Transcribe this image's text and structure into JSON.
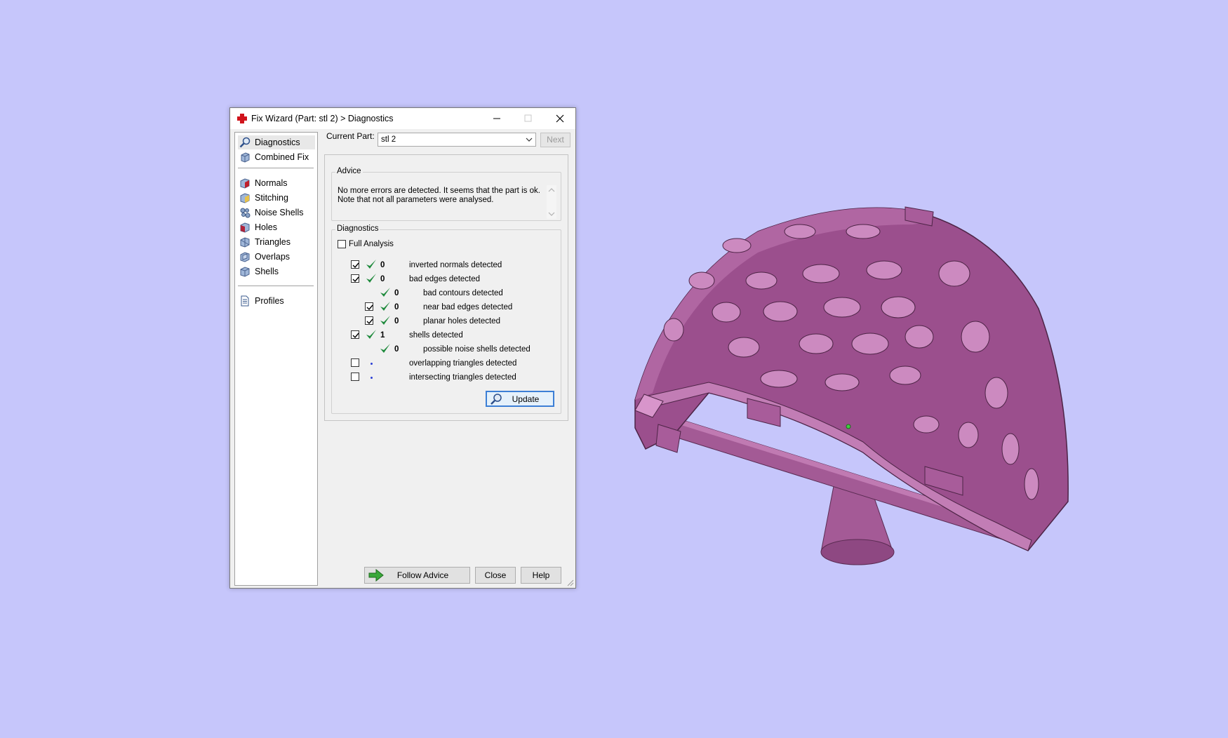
{
  "window": {
    "title": "Fix Wizard (Part: stl 2) > Diagnostics"
  },
  "nav": {
    "items": [
      {
        "label": "Diagnostics",
        "icon": "magnifier-icon",
        "selected": true
      },
      {
        "label": "Combined Fix",
        "icon": "cube-fix-icon"
      },
      {
        "label": "Normals",
        "icon": "normals-cube-icon"
      },
      {
        "label": "Stitching",
        "icon": "stitching-cube-icon"
      },
      {
        "label": "Noise Shells",
        "icon": "noise-shells-icon"
      },
      {
        "label": "Holes",
        "icon": "holes-cube-icon"
      },
      {
        "label": "Triangles",
        "icon": "triangles-cube-icon"
      },
      {
        "label": "Overlaps",
        "icon": "overlaps-cube-icon"
      },
      {
        "label": "Shells",
        "icon": "shells-cube-icon"
      },
      {
        "label": "Profiles",
        "icon": "profile-document-icon"
      }
    ]
  },
  "part": {
    "label": "Current Part:",
    "value": "stl 2",
    "next_label": "Next"
  },
  "advice": {
    "title": "Advice",
    "line1": "No more errors are detected. It seems that the part is ok.",
    "line2": "Note that not all parameters were analysed."
  },
  "diagnostics": {
    "title": "Diagnostics",
    "full_analysis_label": "Full Analysis",
    "full_analysis_checked": false,
    "rows": [
      {
        "checkbox": true,
        "checked": true,
        "status": "ok",
        "count": "0",
        "text": "inverted normals detected",
        "indent": 0
      },
      {
        "checkbox": true,
        "checked": true,
        "status": "ok",
        "count": "0",
        "text": "bad edges detected",
        "indent": 0
      },
      {
        "checkbox": false,
        "checked": false,
        "status": "ok",
        "count": "0",
        "text": "bad contours detected",
        "indent": 1
      },
      {
        "checkbox": true,
        "checked": true,
        "status": "ok",
        "count": "0",
        "text": "near bad edges detected",
        "indent": 1
      },
      {
        "checkbox": true,
        "checked": true,
        "status": "ok",
        "count": "0",
        "text": "planar holes detected",
        "indent": 1
      },
      {
        "checkbox": true,
        "checked": true,
        "status": "ok",
        "count": "1",
        "text": "shells detected",
        "indent": 0
      },
      {
        "checkbox": false,
        "checked": false,
        "status": "ok",
        "count": "0",
        "text": "possible noise shells detected",
        "indent": 1
      },
      {
        "checkbox": true,
        "checked": false,
        "status": "none",
        "count": "",
        "text": "overlapping triangles detected",
        "indent": 0
      },
      {
        "checkbox": true,
        "checked": false,
        "status": "none",
        "count": "",
        "text": "intersecting triangles detected",
        "indent": 0
      }
    ],
    "update_label": "Update"
  },
  "footer": {
    "follow_advice_label": "Follow Advice",
    "close_label": "Close",
    "help_label": "Help"
  },
  "colors": {
    "background": "#c6c6fb",
    "model": "#9a4f8c",
    "check_green": "#1e8a3c"
  }
}
